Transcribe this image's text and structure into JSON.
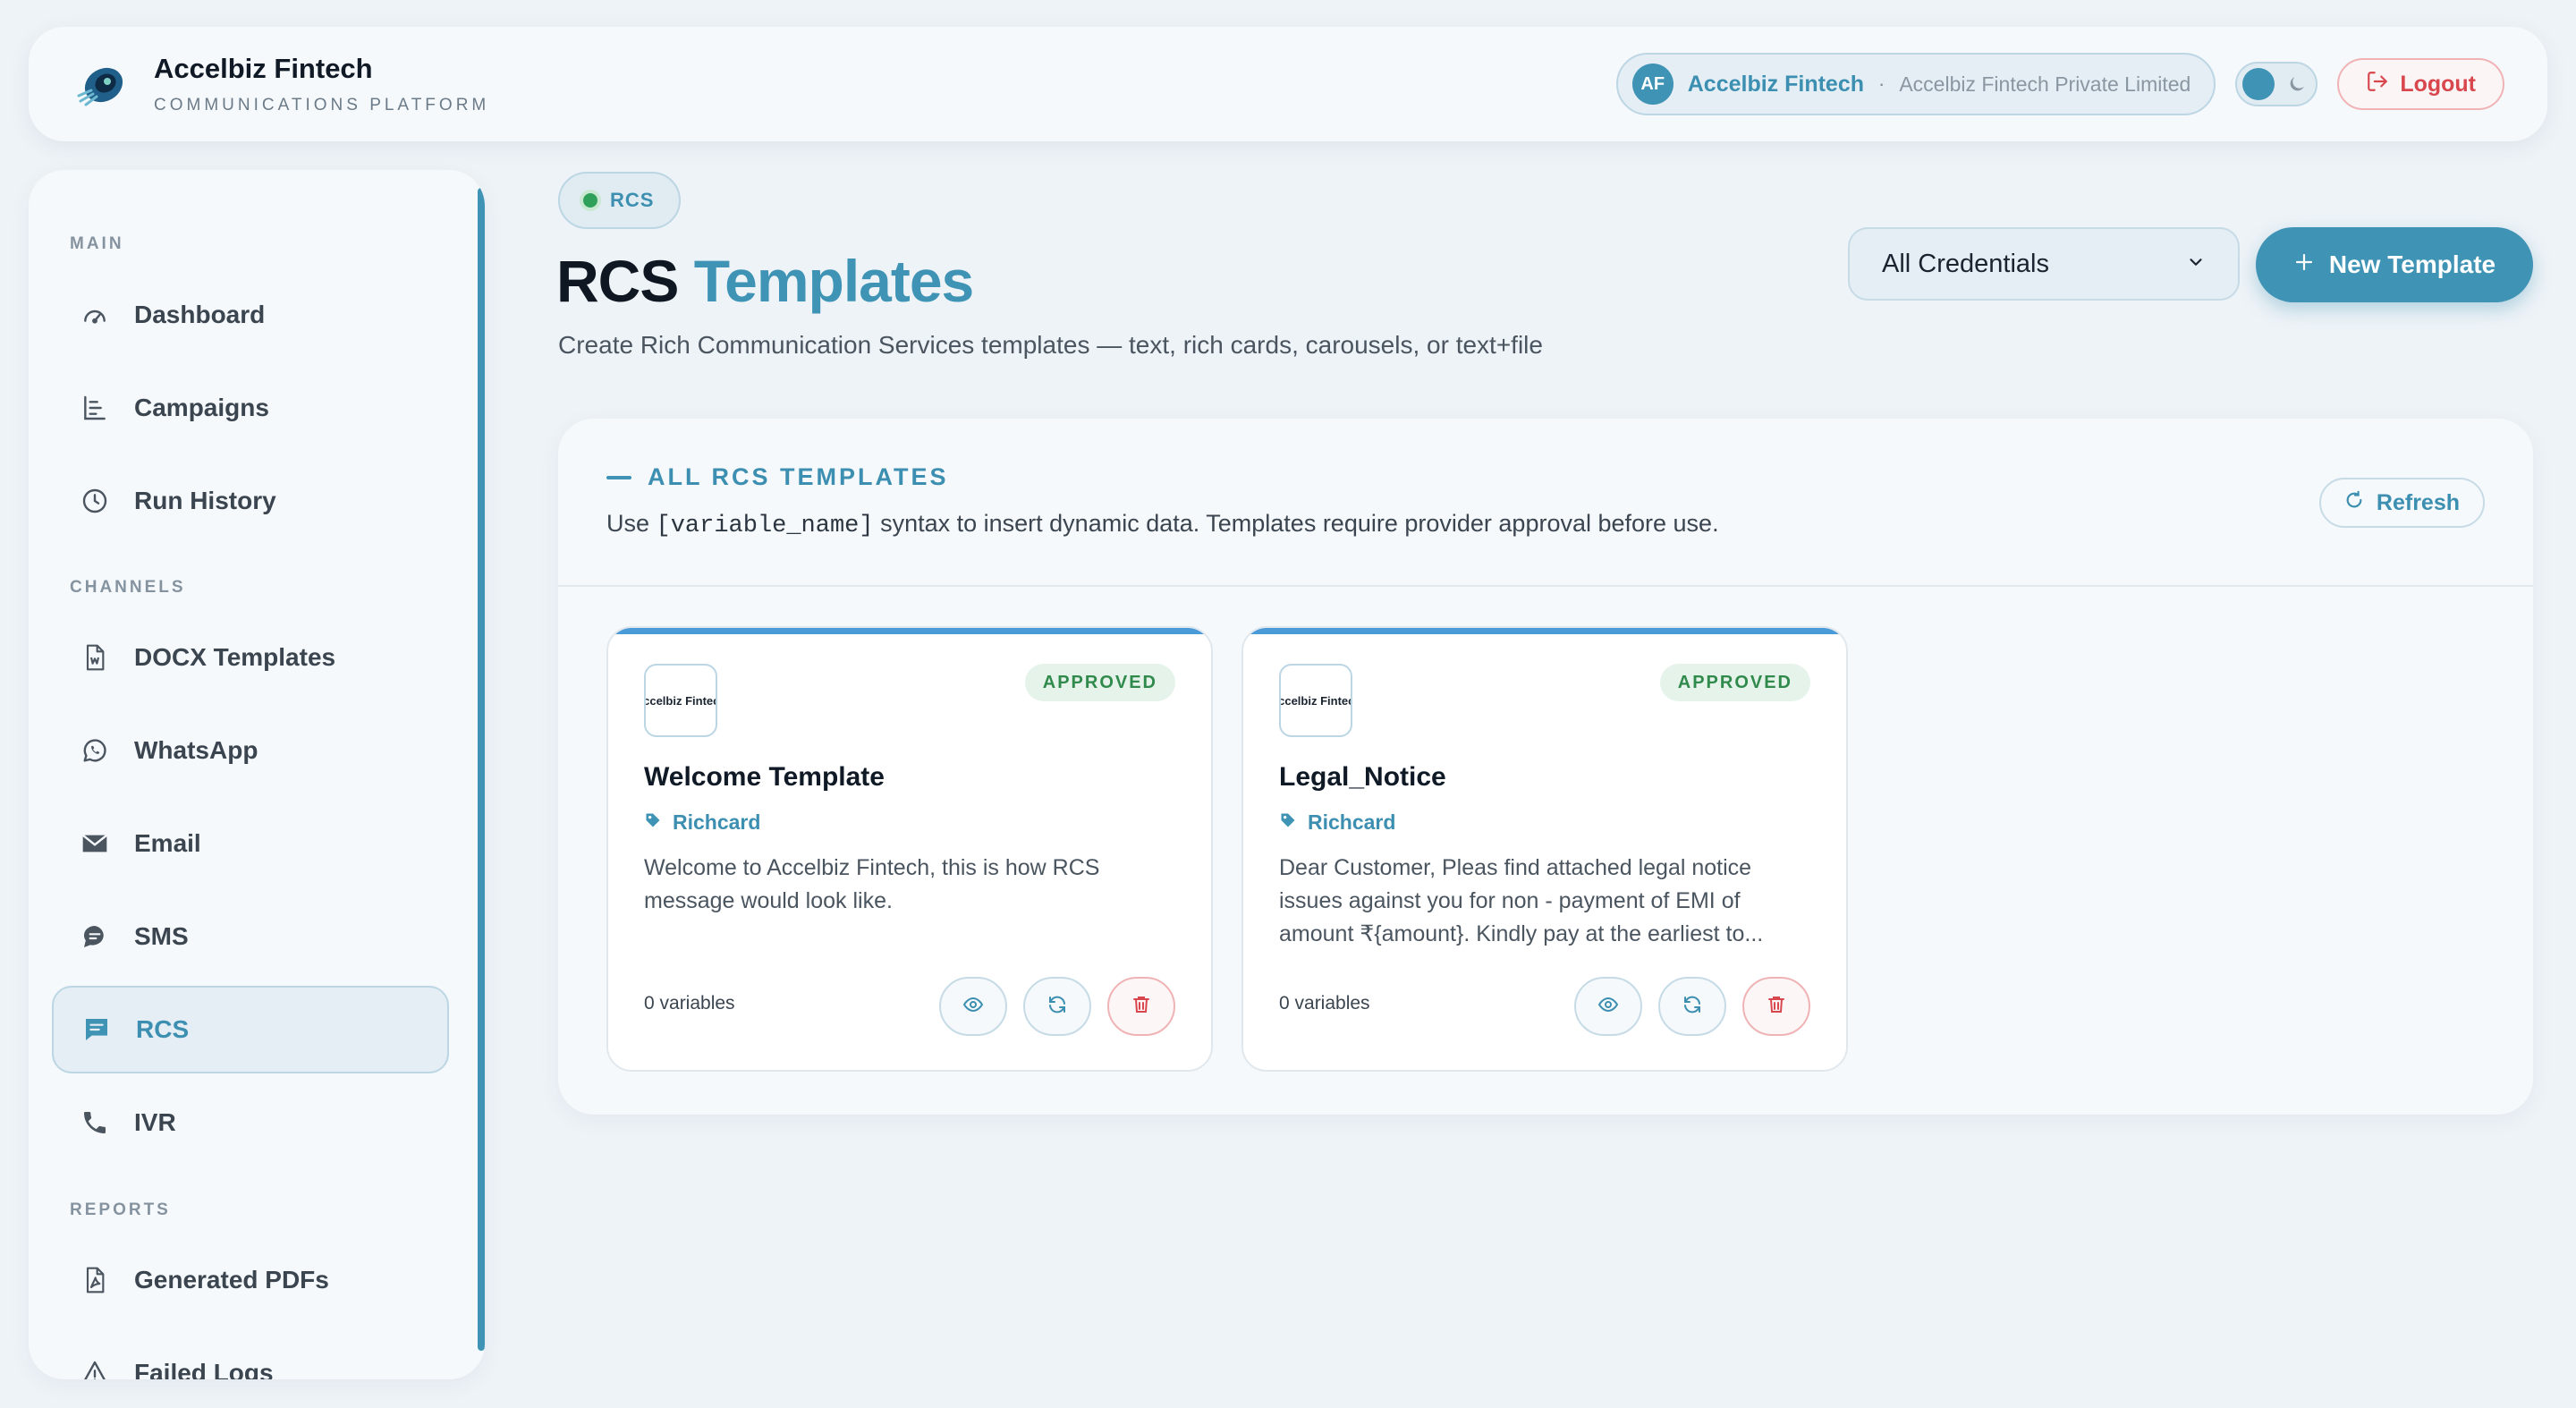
{
  "brand": {
    "name": "Accelbiz Fintech",
    "subtitle": "COMMUNICATIONS PLATFORM"
  },
  "header": {
    "avatar_initials": "AF",
    "org_name": "Accelbiz Fintech",
    "separator": "·",
    "org_company": "Accelbiz Fintech Private Limited",
    "logout_label": "Logout"
  },
  "sidebar": {
    "sections": [
      "MAIN",
      "CHANNELS",
      "REPORTS"
    ],
    "items": [
      {
        "label": "Dashboard",
        "icon": "gauge-icon"
      },
      {
        "label": "Campaigns",
        "icon": "list-tree-icon"
      },
      {
        "label": "Run History",
        "icon": "clock-icon"
      },
      {
        "label": "DOCX Templates",
        "icon": "word-file-icon"
      },
      {
        "label": "WhatsApp",
        "icon": "whatsapp-icon"
      },
      {
        "label": "Email",
        "icon": "envelope-icon"
      },
      {
        "label": "SMS",
        "icon": "chat-bubble-icon"
      },
      {
        "label": "RCS",
        "icon": "message-square-icon",
        "active": true
      },
      {
        "label": "IVR",
        "icon": "phone-icon"
      },
      {
        "label": "Generated PDFs",
        "icon": "pdf-file-icon"
      },
      {
        "label": "Failed Logs",
        "icon": "warning-icon"
      }
    ]
  },
  "main": {
    "chip_label": "RCS",
    "title_plain": "RCS",
    "title_accent": "Templates",
    "subtitle": "Create Rich Communication Services templates — text, rich cards, carousels, or text+file",
    "credential_select": "All Credentials",
    "new_template_label": "New Template"
  },
  "panel": {
    "title": "ALL RCS TEMPLATES",
    "hint_before": "Use ",
    "hint_code": "[variable_name]",
    "hint_after": " syntax to insert dynamic data. Templates require provider approval before use.",
    "refresh_label": "Refresh",
    "templates": [
      {
        "logo_text": "Accelbiz Fintech",
        "status": "APPROVED",
        "name": "Welcome Template",
        "type": "Richcard",
        "body": "Welcome to Accelbiz Fintech, this is how RCS message would look like.",
        "variables": "0 variables"
      },
      {
        "logo_text": "Accelbiz Fintech",
        "status": "APPROVED",
        "name": "Legal_Notice",
        "type": "Richcard",
        "body": "Dear Customer, Pleas find attached legal notice issues against you for non - payment of EMI of amount ₹{amount}. Kindly pay at the earliest to...",
        "variables": "0 variables"
      }
    ]
  },
  "colors": {
    "accent": "#3f93b5",
    "approved": "#2f8a4c",
    "danger": "#d9474e"
  }
}
